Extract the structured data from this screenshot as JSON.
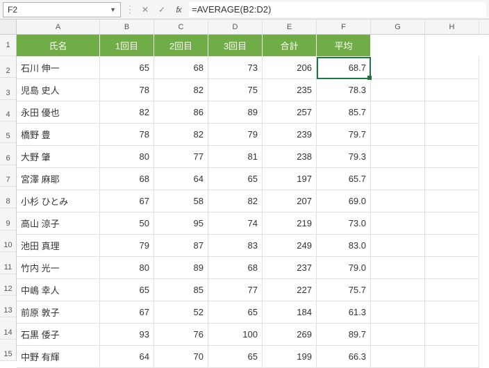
{
  "formula_bar": {
    "active_cell": "F2",
    "formula": "=AVERAGE(B2:D2)"
  },
  "columns": [
    "A",
    "B",
    "C",
    "D",
    "E",
    "F",
    "G",
    "H"
  ],
  "row_numbers": [
    1,
    2,
    3,
    4,
    5,
    6,
    7,
    8,
    9,
    10,
    11,
    12,
    13,
    14,
    15
  ],
  "headers": {
    "name": "氏名",
    "t1": "1回目",
    "t2": "2回目",
    "t3": "3回目",
    "sum": "合計",
    "avg": "平均"
  },
  "data": [
    {
      "name": "石川 伸一",
      "t1": "65",
      "t2": "68",
      "t3": "73",
      "sum": "206",
      "avg": "68.7"
    },
    {
      "name": "児島 史人",
      "t1": "78",
      "t2": "82",
      "t3": "75",
      "sum": "235",
      "avg": "78.3"
    },
    {
      "name": "永田 優也",
      "t1": "82",
      "t2": "86",
      "t3": "89",
      "sum": "257",
      "avg": "85.7"
    },
    {
      "name": "橋野 豊",
      "t1": "78",
      "t2": "82",
      "t3": "79",
      "sum": "239",
      "avg": "79.7"
    },
    {
      "name": "大野 肇",
      "t1": "80",
      "t2": "77",
      "t3": "81",
      "sum": "238",
      "avg": "79.3"
    },
    {
      "name": "宮澤 麻耶",
      "t1": "68",
      "t2": "64",
      "t3": "65",
      "sum": "197",
      "avg": "65.7"
    },
    {
      "name": "小杉 ひとみ",
      "t1": "67",
      "t2": "58",
      "t3": "82",
      "sum": "207",
      "avg": "69.0"
    },
    {
      "name": "高山 涼子",
      "t1": "50",
      "t2": "95",
      "t3": "74",
      "sum": "219",
      "avg": "73.0"
    },
    {
      "name": "池田 真理",
      "t1": "79",
      "t2": "87",
      "t3": "83",
      "sum": "249",
      "avg": "83.0"
    },
    {
      "name": "竹内 光一",
      "t1": "80",
      "t2": "89",
      "t3": "68",
      "sum": "237",
      "avg": "79.0"
    },
    {
      "name": "中嶋 幸人",
      "t1": "65",
      "t2": "85",
      "t3": "77",
      "sum": "227",
      "avg": "75.7"
    },
    {
      "name": "前原 敦子",
      "t1": "67",
      "t2": "52",
      "t3": "65",
      "sum": "184",
      "avg": "61.3"
    },
    {
      "name": "石黒 倭子",
      "t1": "93",
      "t2": "76",
      "t3": "100",
      "sum": "269",
      "avg": "89.7"
    },
    {
      "name": "中野 有輝",
      "t1": "64",
      "t2": "70",
      "t3": "65",
      "sum": "199",
      "avg": "66.3"
    }
  ],
  "chart_data": {
    "type": "table",
    "columns": [
      "氏名",
      "1回目",
      "2回目",
      "3回目",
      "合計",
      "平均"
    ],
    "rows": [
      [
        "石川 伸一",
        65,
        68,
        73,
        206,
        68.7
      ],
      [
        "児島 史人",
        78,
        82,
        75,
        235,
        78.3
      ],
      [
        "永田 優也",
        82,
        86,
        89,
        257,
        85.7
      ],
      [
        "橋野 豊",
        78,
        82,
        79,
        239,
        79.7
      ],
      [
        "大野 肇",
        80,
        77,
        81,
        238,
        79.3
      ],
      [
        "宮澤 麻耶",
        68,
        64,
        65,
        197,
        65.7
      ],
      [
        "小杉 ひとみ",
        67,
        58,
        82,
        207,
        69.0
      ],
      [
        "高山 涼子",
        50,
        95,
        74,
        219,
        73.0
      ],
      [
        "池田 真理",
        79,
        87,
        83,
        249,
        83.0
      ],
      [
        "竹内 光一",
        80,
        89,
        68,
        237,
        79.0
      ],
      [
        "中嶋 幸人",
        65,
        85,
        77,
        227,
        75.7
      ],
      [
        "前原 敦子",
        67,
        52,
        65,
        184,
        61.3
      ],
      [
        "石黒 倭子",
        93,
        76,
        100,
        269,
        89.7
      ],
      [
        "中野 有輝",
        64,
        70,
        65,
        199,
        66.3
      ]
    ]
  }
}
